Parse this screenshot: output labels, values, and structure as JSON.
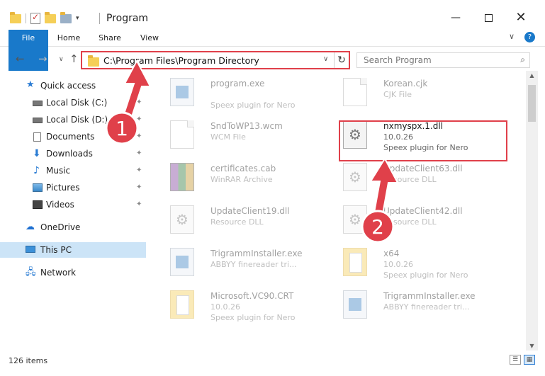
{
  "window": {
    "title": "Program",
    "min": "—",
    "max": "",
    "close": "✕"
  },
  "ribbon": {
    "tabs": [
      "File",
      "Home",
      "Share",
      "View"
    ],
    "collapse": "∨",
    "help": "?"
  },
  "address": {
    "path": "C:\\Program Files\\Program Directory",
    "dropdown": "∨",
    "refresh": "↻"
  },
  "nav": {
    "back": "←",
    "forward": "→",
    "recent": "∨",
    "up": "↑"
  },
  "search": {
    "placeholder": "Search Program",
    "icon": "⌕"
  },
  "sidebar": {
    "items": [
      {
        "label": "Quick access",
        "icon": "star-icon",
        "pinned": false
      },
      {
        "label": "Local Disk (C:)",
        "icon": "drive-icon",
        "pinned": true
      },
      {
        "label": "Local Disk (D:)",
        "icon": "drive-icon",
        "pinned": true
      },
      {
        "label": "Documents",
        "icon": "documents-icon",
        "pinned": true
      },
      {
        "label": "Downloads",
        "icon": "downloads-icon",
        "pinned": true
      },
      {
        "label": "Music",
        "icon": "music-icon",
        "pinned": true
      },
      {
        "label": "Pictures",
        "icon": "pictures-icon",
        "pinned": true
      },
      {
        "label": "Videos",
        "icon": "videos-icon",
        "pinned": true
      },
      {
        "label": "OneDrive",
        "icon": "onedrive-icon",
        "pinned": false
      },
      {
        "label": "This PC",
        "icon": "this-pc-icon",
        "pinned": false,
        "selected": true
      },
      {
        "label": "Network",
        "icon": "network-icon",
        "pinned": false
      }
    ],
    "pin_glyph": "📌"
  },
  "files": [
    {
      "name": "program.exe",
      "line2": "",
      "line3": "Speex plugin for Nero",
      "icon": "exe-icon",
      "dim": true
    },
    {
      "name": "Korean.cjk",
      "line2": "CJK File",
      "line3": "",
      "icon": "page-icon",
      "dim": true
    },
    {
      "name": "SndToWP13.wcm",
      "line2": "WCM File",
      "line3": "",
      "icon": "page-icon",
      "dim": true
    },
    {
      "name": "nxmyspx.1.dll",
      "line2": "10.0.26",
      "line3": "Speex plugin for Nero",
      "icon": "dll-gear-icon",
      "dim": false
    },
    {
      "name": "certificates.cab",
      "line2": "WinRAR Archive",
      "line3": "",
      "icon": "winrar-icon",
      "dim": true
    },
    {
      "name": "UpdateClient63.dll",
      "line2": "Resource DLL",
      "line3": "",
      "icon": "dll-gear-icon",
      "dim": true
    },
    {
      "name": "UpdateClient19.dll",
      "line2": "Resource DLL",
      "line3": "",
      "icon": "dll-gear-icon",
      "dim": true
    },
    {
      "name": "UpdateClient42.dll",
      "line2": "Resource DLL",
      "line3": "",
      "icon": "dll-gear-icon",
      "dim": true
    },
    {
      "name": "TrigrammInstaller.exe",
      "line2": "ABBYY finereader tri...",
      "line3": "",
      "icon": "exe-icon",
      "dim": true
    },
    {
      "name": "x64",
      "line2": "10.0.26",
      "line3": "Speex plugin for Nero",
      "icon": "folder-icon",
      "dim": true
    },
    {
      "name": "Microsoft.VC90.CRT",
      "line2": "10.0.26",
      "line3": "Speex plugin for Nero",
      "icon": "folder-icon",
      "dim": true
    },
    {
      "name": "TrigrammInstaller.exe",
      "line2": "ABBYY finereader tri...",
      "line3": "",
      "icon": "exe-icon",
      "dim": true
    }
  ],
  "annotations": {
    "step1": "1",
    "step2": "2"
  },
  "status": {
    "count": "126 items"
  },
  "colors": {
    "accent": "#1979ca",
    "highlight": "#e0404a",
    "selected": "#cce4f7"
  }
}
